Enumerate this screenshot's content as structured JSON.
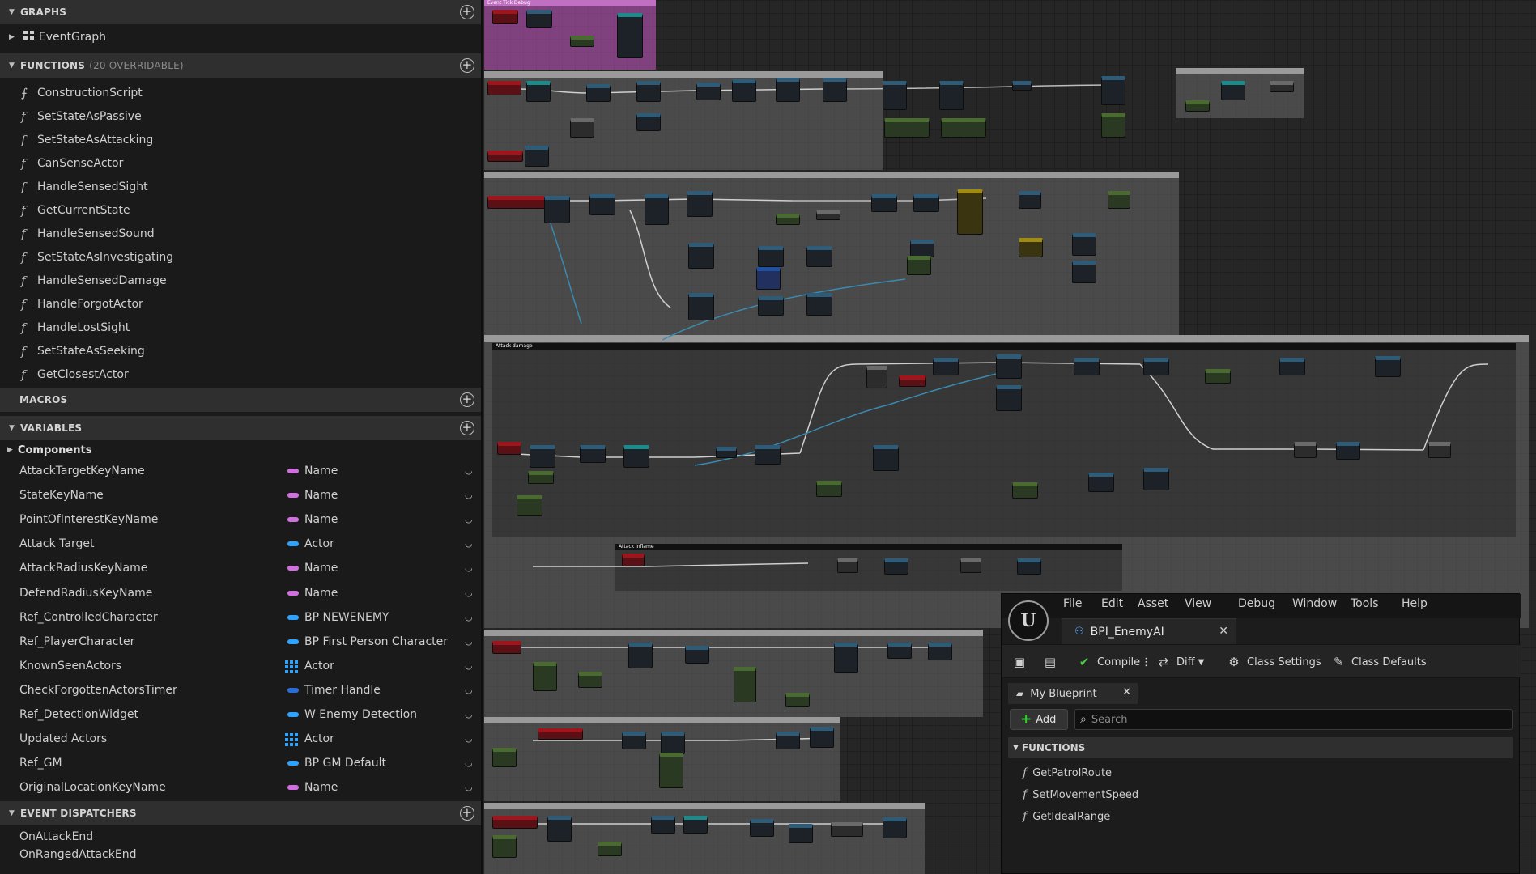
{
  "graphs": {
    "header": "GRAPHS",
    "items": [
      {
        "label": "EventGraph",
        "icon": "event-graph-icon"
      }
    ]
  },
  "functions": {
    "header": "FUNCTIONS",
    "subheader": "(20 OVERRIDABLE)",
    "items": [
      "ConstructionScript",
      "SetStateAsPassive",
      "SetStateAsAttacking",
      "CanSenseActor",
      "HandleSensedSight",
      "GetCurrentState",
      "HandleSensedSound",
      "SetStateAsInvestigating",
      "HandleSensedDamage",
      "HandleForgotActor",
      "HandleLostSight",
      "SetStateAsSeeking",
      "GetClosestActor"
    ]
  },
  "macros": {
    "header": "MACROS"
  },
  "variables": {
    "header": "VARIABLES",
    "components_label": "Components",
    "items": [
      {
        "name": "AttackTargetKeyName",
        "type": "Name",
        "color": "#d070e0",
        "kind": "pill"
      },
      {
        "name": "StateKeyName",
        "type": "Name",
        "color": "#d070e0",
        "kind": "pill"
      },
      {
        "name": "PointOfInterestKeyName",
        "type": "Name",
        "color": "#d070e0",
        "kind": "pill"
      },
      {
        "name": "Attack Target",
        "type": "Actor",
        "color": "#2ea3ff",
        "kind": "pill"
      },
      {
        "name": "AttackRadiusKeyName",
        "type": "Name",
        "color": "#d070e0",
        "kind": "pill"
      },
      {
        "name": "DefendRadiusKeyName",
        "type": "Name",
        "color": "#d070e0",
        "kind": "pill"
      },
      {
        "name": "Ref_ControlledCharacter",
        "type": "BP NEWENEMY",
        "color": "#2ea3ff",
        "kind": "pill"
      },
      {
        "name": "Ref_PlayerCharacter",
        "type": "BP First Person Character",
        "color": "#2ea3ff",
        "kind": "pill"
      },
      {
        "name": "KnownSeenActors",
        "type": "Actor",
        "color": "#2ea3ff",
        "kind": "grid"
      },
      {
        "name": "CheckForgottenActorsTimer",
        "type": "Timer Handle",
        "color": "#2a6cd8",
        "kind": "pill"
      },
      {
        "name": "Ref_DetectionWidget",
        "type": "W Enemy Detection",
        "color": "#2ea3ff",
        "kind": "pill"
      },
      {
        "name": "Updated Actors",
        "type": "Actor",
        "color": "#2ea3ff",
        "kind": "grid"
      },
      {
        "name": "Ref_GM",
        "type": "BP GM Default",
        "color": "#2ea3ff",
        "kind": "pill"
      },
      {
        "name": "OriginalLocationKeyName",
        "type": "Name",
        "color": "#d070e0",
        "kind": "pill"
      }
    ]
  },
  "event_dispatchers": {
    "header": "EVENT DISPATCHERS",
    "items": [
      "OnAttackEnd",
      "OnRangedAttackEnd"
    ]
  },
  "graph_canvas": {
    "comment_labels": [
      "Event Tick Debug",
      "Attack damage",
      "Attack inflame"
    ]
  },
  "blueprint_window": {
    "menu": [
      "File",
      "Edit",
      "Asset",
      "View",
      "Debug",
      "Window",
      "Tools",
      "Help"
    ],
    "tab_title": "BPI_EnemyAI",
    "toolbar": {
      "compile": "Compile",
      "diff": "Diff",
      "class_settings": "Class Settings",
      "class_defaults": "Class Defaults"
    },
    "panel_tab": "My Blueprint",
    "add_label": "Add",
    "search_placeholder": "Search",
    "functions_header": "FUNCTIONS",
    "functions": [
      "GetPatrolRoute",
      "SetMovementSpeed",
      "GetIdealRange"
    ]
  }
}
